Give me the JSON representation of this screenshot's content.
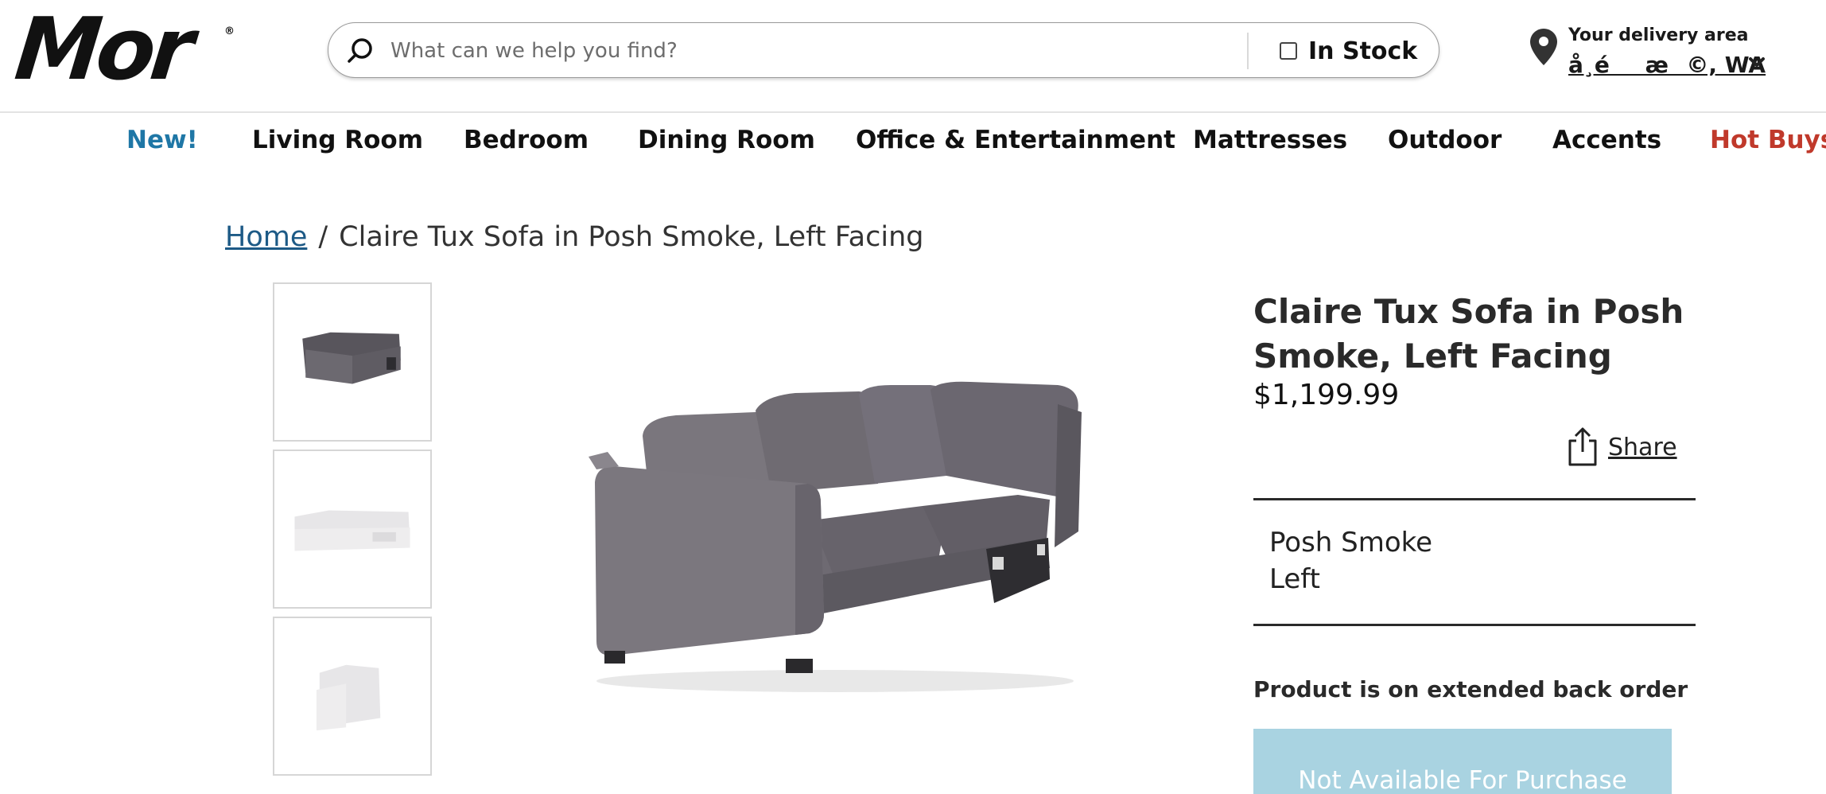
{
  "brand": {
    "logo_text": "Mor",
    "registered_mark": "®"
  },
  "search": {
    "placeholder": "What can we help you find?",
    "value": "",
    "in_stock_label": "In Stock",
    "in_stock_checked": false,
    "icon": "search-icon"
  },
  "delivery": {
    "label": "Your delivery area",
    "location": "å¸éæ©, WA",
    "icon": "map-pin-icon"
  },
  "nav": {
    "items": [
      {
        "label": "New!",
        "color": "#1f77a6"
      },
      {
        "label": "Living Room",
        "color": "#111111"
      },
      {
        "label": "Bedroom",
        "color": "#111111"
      },
      {
        "label": "Dining Room",
        "color": "#111111"
      },
      {
        "label": "Office & Entertainment",
        "color": "#111111"
      },
      {
        "label": "Mattresses",
        "color": "#111111"
      },
      {
        "label": "Outdoor",
        "color": "#111111"
      },
      {
        "label": "Accents",
        "color": "#111111"
      },
      {
        "label": "Hot Buys",
        "color": "#c0392b"
      }
    ]
  },
  "breadcrumb": {
    "home": "Home",
    "separator": "/",
    "current": "Claire Tux Sofa in Posh Smoke, Left Facing"
  },
  "product": {
    "title": "Claire Tux Sofa in Posh Smoke, Left Facing",
    "price": "$1,199.99",
    "share_label": "Share",
    "variants": {
      "color": "Posh Smoke",
      "orientation": "Left"
    },
    "stock_message": "Product is on extended back order",
    "purchase_button": "Not Available For Purchase",
    "thumbnail_count": 3
  },
  "colors": {
    "accent_link": "#1d5a86",
    "hot_buys": "#c0392b",
    "disabled_button": "#a9d3e1",
    "sofa_fabric": "#6f6b72"
  }
}
